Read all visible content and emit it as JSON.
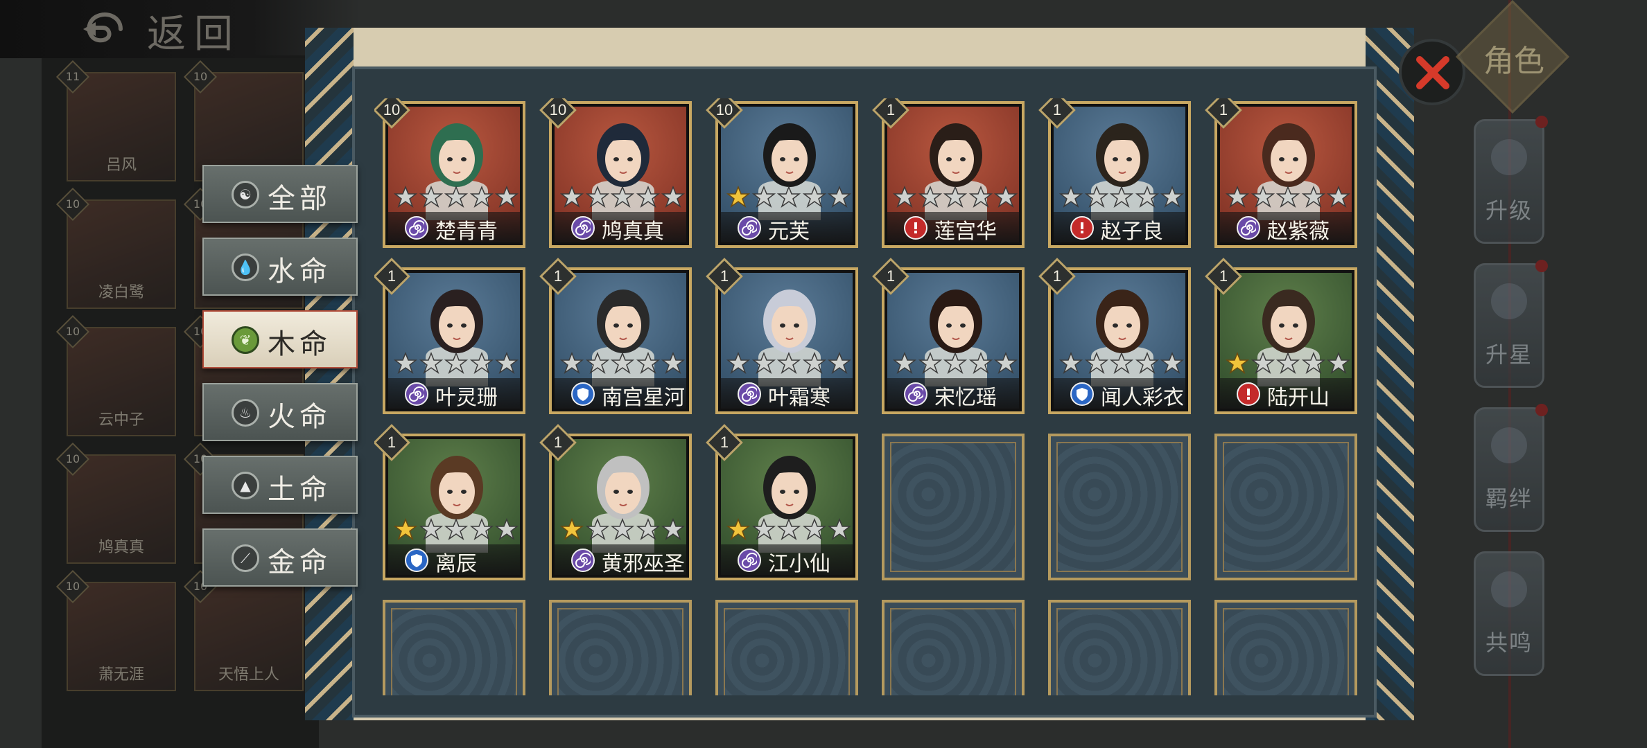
{
  "header": {
    "back_label": "返回"
  },
  "filter_tabs": [
    {
      "label": "全部",
      "icon": "yin-yang-icon",
      "active": false
    },
    {
      "label": "水命",
      "icon": "water-drop-icon",
      "active": false
    },
    {
      "label": "木命",
      "icon": "leaf-icon",
      "active": true
    },
    {
      "label": "火命",
      "icon": "flame-icon",
      "active": false
    },
    {
      "label": "土命",
      "icon": "mountain-icon",
      "active": false
    },
    {
      "label": "金命",
      "icon": "blade-icon",
      "active": false
    }
  ],
  "background_list": [
    {
      "level": "11",
      "name": "吕风"
    },
    {
      "level": "10",
      "name": ""
    },
    {
      "level": "10",
      "name": "凌白鹭"
    },
    {
      "level": "10",
      "name": ""
    },
    {
      "level": "10",
      "name": "云中子"
    },
    {
      "level": "10",
      "name": ""
    },
    {
      "level": "10",
      "name": "鸠真真"
    },
    {
      "level": "10",
      "name": ""
    },
    {
      "level": "10",
      "name": "萧无涯"
    },
    {
      "level": "10",
      "name": "天悟上人"
    }
  ],
  "characters": [
    {
      "name": "楚青青",
      "level": "10",
      "stars": 0,
      "badge": "spiral",
      "bg": "red"
    },
    {
      "name": "鸠真真",
      "level": "10",
      "stars": 0,
      "badge": "spiral",
      "bg": "red"
    },
    {
      "name": "元芙",
      "level": "10",
      "stars": 1,
      "badge": "spiral",
      "bg": "blue"
    },
    {
      "name": "莲宫华",
      "level": "1",
      "stars": 0,
      "badge": "alert",
      "bg": "red"
    },
    {
      "name": "赵子良",
      "level": "1",
      "stars": 0,
      "badge": "alert",
      "bg": "blue"
    },
    {
      "name": "赵紫薇",
      "level": "1",
      "stars": 0,
      "badge": "spiral",
      "bg": "red"
    },
    {
      "name": "叶灵珊",
      "level": "1",
      "stars": 0,
      "badge": "spiral",
      "bg": "blue"
    },
    {
      "name": "南宫星河",
      "level": "1",
      "stars": 0,
      "badge": "shield",
      "bg": "blue"
    },
    {
      "name": "叶霜寒",
      "level": "1",
      "stars": 0,
      "badge": "spiral",
      "bg": "blue"
    },
    {
      "name": "宋忆瑶",
      "level": "1",
      "stars": 0,
      "badge": "spiral",
      "bg": "blue"
    },
    {
      "name": "闻人彩衣",
      "level": "1",
      "stars": 0,
      "badge": "shield",
      "bg": "blue"
    },
    {
      "name": "陆开山",
      "level": "1",
      "stars": 1,
      "badge": "alert",
      "bg": "green"
    },
    {
      "name": "离辰",
      "level": "1",
      "stars": 1,
      "badge": "shield",
      "bg": "green"
    },
    {
      "name": "黄邪巫圣",
      "level": "1",
      "stars": 1,
      "badge": "spiral",
      "bg": "green"
    },
    {
      "name": "江小仙",
      "level": "1",
      "stars": 1,
      "badge": "spiral",
      "bg": "green"
    }
  ],
  "empty_slots": 9,
  "side_menu": {
    "title": "角色",
    "buttons": [
      {
        "label": "升级",
        "has_dot": true
      },
      {
        "label": "升星",
        "has_dot": true
      },
      {
        "label": "羁绊",
        "has_dot": true
      },
      {
        "label": "共鸣",
        "has_dot": false
      }
    ]
  },
  "colors": {
    "active_tab_border": "#b24d3a",
    "card_border": "#c8a862",
    "star_on": "#f1c43b",
    "close_x": "#d63a2a"
  }
}
